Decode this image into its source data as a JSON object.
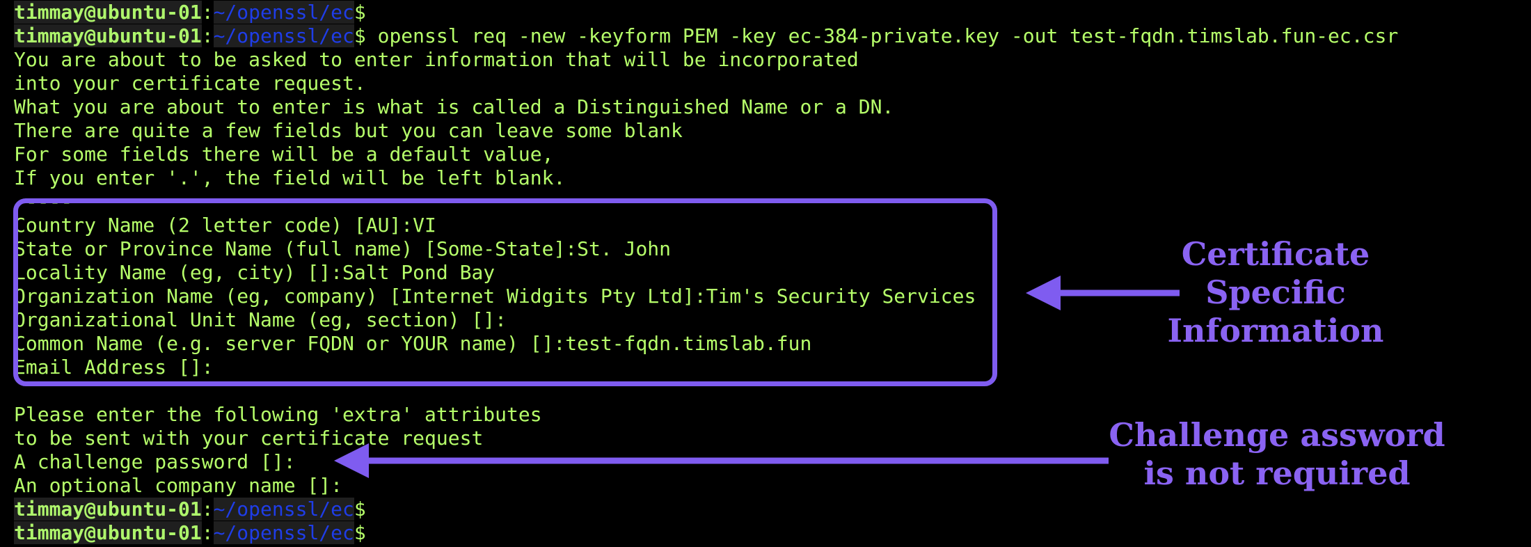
{
  "terminal": {
    "user": "timmay@ubuntu-01",
    "path": "~/openssl/ec",
    "prompt_symbol": "$",
    "command": " openssl req -new -keyform PEM -key ec-384-private.key -out test-fqdn.timslab.fun-ec.csr",
    "output": [
      "You are about to be asked to enter information that will be incorporated",
      "into your certificate request.",
      "What you are about to enter is what is called a Distinguished Name or a DN.",
      "There are quite a few fields but you can leave some blank",
      "For some fields there will be a default value,",
      "If you enter '.', the field will be left blank.",
      "-----",
      "Country Name (2 letter code) [AU]:VI",
      "State or Province Name (full name) [Some-State]:St. John",
      "Locality Name (eg, city) []:Salt Pond Bay",
      "Organization Name (eg, company) [Internet Widgits Pty Ltd]:Tim's Security Services",
      "Organizational Unit Name (eg, section) []:",
      "Common Name (e.g. server FQDN or YOUR name) []:test-fqdn.timslab.fun",
      "Email Address []:",
      "",
      "Please enter the following 'extra' attributes",
      "to be sent with your certificate request",
      "A challenge password []:",
      "An optional company name []:"
    ]
  },
  "annotations": {
    "certificate": "Certificate\nSpecific\nInformation",
    "challenge": "Challenge assword\nis not required"
  },
  "colors": {
    "text": "#b6ff6a",
    "path": "#1f3de8",
    "annotation": "#8a63f2",
    "background": "#000000"
  }
}
